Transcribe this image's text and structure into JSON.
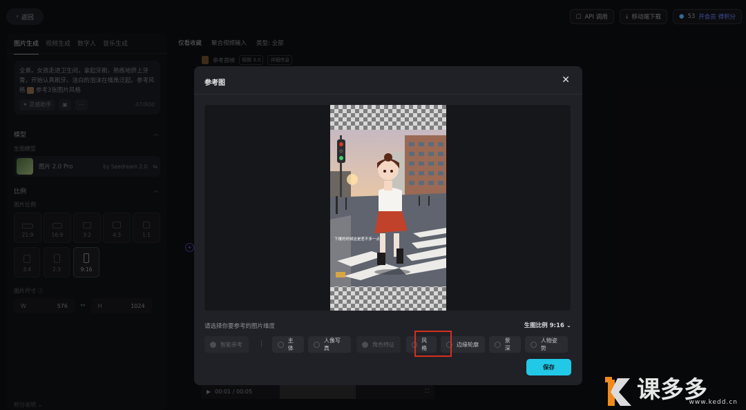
{
  "topbar": {
    "back_label": "返回",
    "api_label": "API 调用",
    "download_label": "移动端下载",
    "credits": "53",
    "vip_label": "开会员 得积分"
  },
  "left_panel": {
    "tabs": [
      "图片生成",
      "视频生成",
      "数字人",
      "音乐生成"
    ],
    "prompt_text": "全景。女孩走进卫生间，拿起牙刷，熟练地挤上牙膏，开始认真刷牙。洁白的泡沫在嘴角泛起。参考风格",
    "prompt_ref": "参考3张图片风格",
    "prompt_tool_label": "灵感助手",
    "prompt_count": "47/800",
    "model_section": "模型",
    "model_sub": "生图模型",
    "model_name": "图片 2.0 Pro",
    "model_by": "by Seedream 2.0",
    "ratio_section": "比例",
    "ratio_sub": "图片比例",
    "ratios": [
      "21:9",
      "16:9",
      "3:2",
      "4:3",
      "1:1",
      "3:4",
      "2:3",
      "9:16"
    ],
    "active_ratio": "9:16",
    "size_label": "图片尺寸",
    "width_prefix": "W",
    "width_value": "576",
    "height_prefix": "H",
    "height_value": "1024",
    "footer": "积分说明"
  },
  "main": {
    "tabs": [
      "仅看收藏",
      "聚合视频输入",
      "类型: 全部"
    ],
    "feed_title": "参考首帧",
    "feed_chip1": "视频 3.0",
    "feed_chip2": "详细信息",
    "player_time": "00:01 / 00:05"
  },
  "modal": {
    "title": "参考图",
    "caption_overlay": "下楼的时候这是差不多一点",
    "dimension_label": "请选择你要参考的图片维度",
    "ratio_select": "生图比例 9:16",
    "options": [
      {
        "label": "智能参考",
        "disabled": true
      },
      {
        "label": "主体",
        "disabled": false
      },
      {
        "label": "人像写真",
        "disabled": false
      },
      {
        "label": "角色特征",
        "disabled": true
      },
      {
        "label": "风格",
        "disabled": false
      },
      {
        "label": "边缘轮廓",
        "disabled": false
      },
      {
        "label": "景深",
        "disabled": false
      },
      {
        "label": "人物姿势",
        "disabled": false
      }
    ],
    "save_label": "保存"
  },
  "watermark": {
    "brand": "课多多",
    "url": "www.kedd.cn"
  },
  "colors": {
    "accent": "#22c9e6",
    "highlight": "#d4301f",
    "background": "#0d0e11",
    "modal": "#1f2126"
  }
}
